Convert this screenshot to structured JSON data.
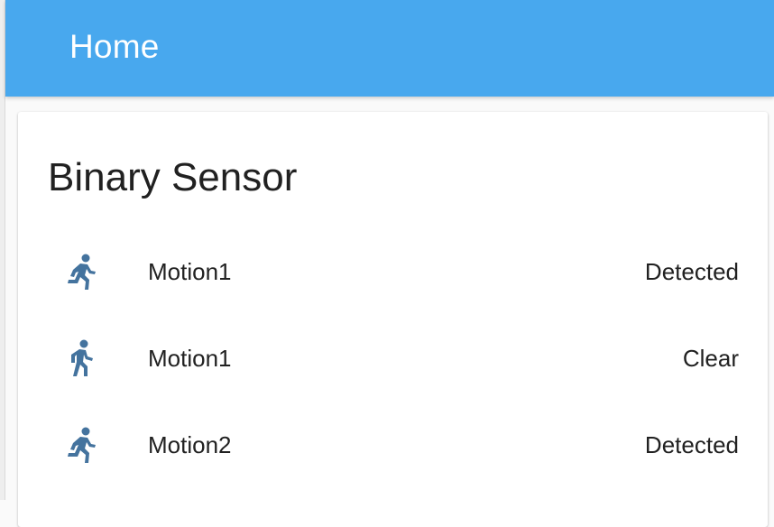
{
  "header": {
    "title": "Home",
    "background_color": "#48a8ee"
  },
  "card": {
    "title": "Binary Sensor",
    "entities": [
      {
        "name": "Motion1",
        "state": "Detected",
        "icon": "run-fast-icon",
        "icon_color": "#44739e"
      },
      {
        "name": "Motion1",
        "state": "Clear",
        "icon": "walk-icon",
        "icon_color": "#44739e"
      },
      {
        "name": "Motion2",
        "state": "Detected",
        "icon": "run-fast-icon",
        "icon_color": "#44739e"
      }
    ]
  }
}
